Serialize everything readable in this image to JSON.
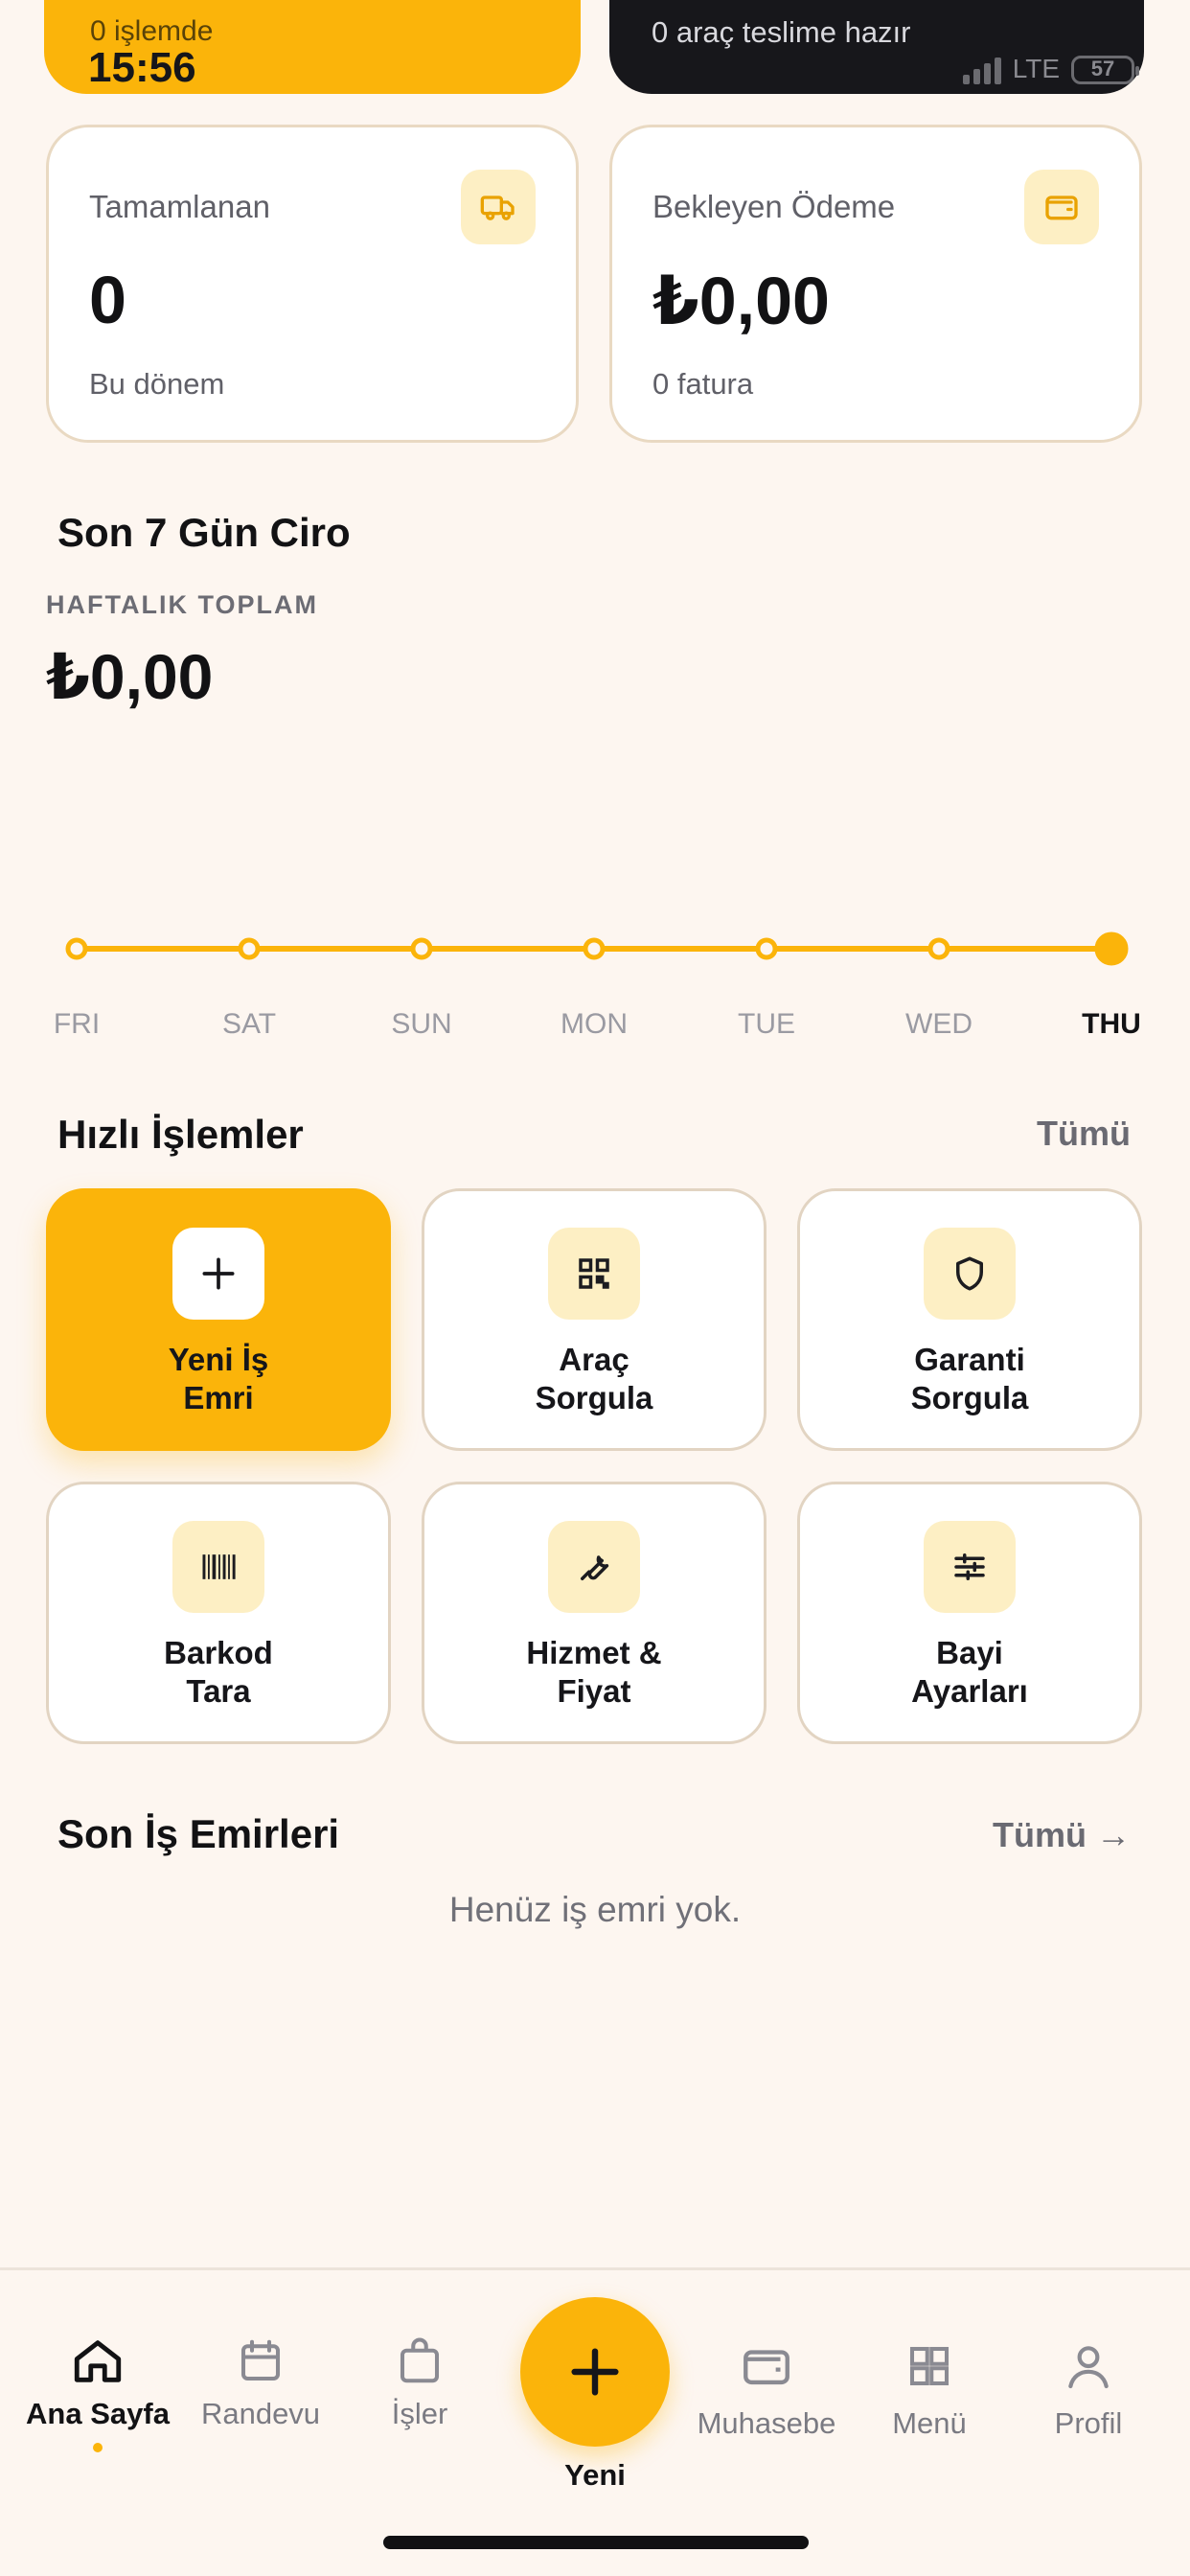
{
  "top": {
    "left_sub": "0 işlemde",
    "time": "15:56",
    "right_text": "0 araç teslime hazır",
    "network": "LTE",
    "battery": "57"
  },
  "stats": [
    {
      "label": "Tamamlanan",
      "value": "0",
      "note": "Bu dönem",
      "icon": "truck-icon"
    },
    {
      "label": "Bekleyen Ödeme",
      "value": "₺0,00",
      "note": "0 fatura",
      "icon": "wallet-icon"
    }
  ],
  "revenue": {
    "title": "Son 7 Gün Ciro",
    "overline": "HAFTALIK TOPLAM",
    "total": "₺0,00"
  },
  "chart_data": {
    "type": "line",
    "categories": [
      "FRI",
      "SAT",
      "SUN",
      "MON",
      "TUE",
      "WED",
      "THU"
    ],
    "values": [
      0,
      0,
      0,
      0,
      0,
      0,
      0
    ],
    "highlighted": "THU",
    "color": "#fbb40a",
    "grid": false
  },
  "quick": {
    "title": "Hızlı İşlemler",
    "link": "Tümü",
    "items": [
      {
        "label1": "Yeni İş",
        "label2": "Emri",
        "icon": "plus-icon",
        "primary": true
      },
      {
        "label1": "Araç",
        "label2": "Sorgula",
        "icon": "qr-icon"
      },
      {
        "label1": "Garanti",
        "label2": "Sorgula",
        "icon": "shield-icon"
      },
      {
        "label1": "Barkod",
        "label2": "Tara",
        "icon": "barcode-icon"
      },
      {
        "label1": "Hizmet &",
        "label2": "Fiyat",
        "icon": "wrench-icon"
      },
      {
        "label1": "Bayi",
        "label2": "Ayarları",
        "icon": "sliders-icon"
      }
    ]
  },
  "orders": {
    "title": "Son İş Emirleri",
    "link": "Tümü →",
    "empty": "Henüz iş emri yok."
  },
  "nav": {
    "items": [
      {
        "label": "Ana Sayfa",
        "icon": "home-icon",
        "active": true
      },
      {
        "label": "Randevu",
        "icon": "calendar-icon"
      },
      {
        "label": "İşler",
        "icon": "bag-icon"
      },
      {
        "label": "Muhasebe",
        "icon": "wallet-icon"
      },
      {
        "label": "Menü",
        "icon": "grid-icon"
      },
      {
        "label": "Profil",
        "icon": "user-icon"
      }
    ],
    "fab_label": "Yeni"
  },
  "colors": {
    "accent": "#fbb40a",
    "background": "#fdf6f0",
    "dark": "#17171b"
  }
}
